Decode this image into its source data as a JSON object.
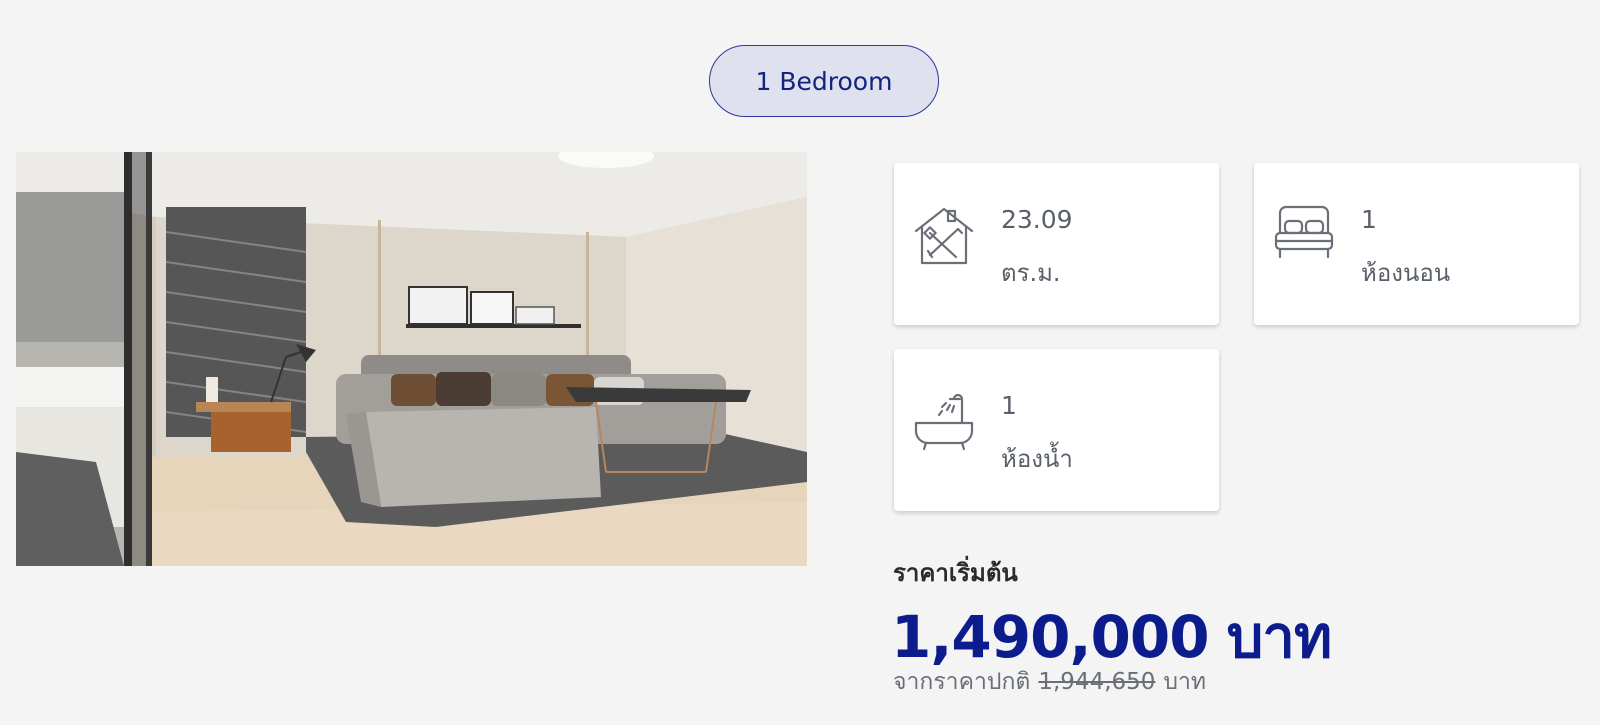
{
  "tab": {
    "label": "1 Bedroom"
  },
  "specs": {
    "area": {
      "value": "23.09",
      "unit": "ตร.ม.",
      "icon": "house-measure-icon"
    },
    "bedroom": {
      "value": "1",
      "label": "ห้องนอน",
      "icon": "bed-icon"
    },
    "bathroom": {
      "value": "1",
      "label": "ห้องน้ำ",
      "icon": "bathtub-icon"
    }
  },
  "price": {
    "caption": "ราคาเริ่มต้น",
    "amount": "1,490,000",
    "currency": "บาท",
    "old_prefix": "จากราคาปกติ",
    "old_amount": "1,944,650",
    "old_currency": "บาท"
  },
  "colors": {
    "accent": "#0c1c8c",
    "pill_bg": "#dfe1ee",
    "page_bg": "#f4f4f4"
  }
}
